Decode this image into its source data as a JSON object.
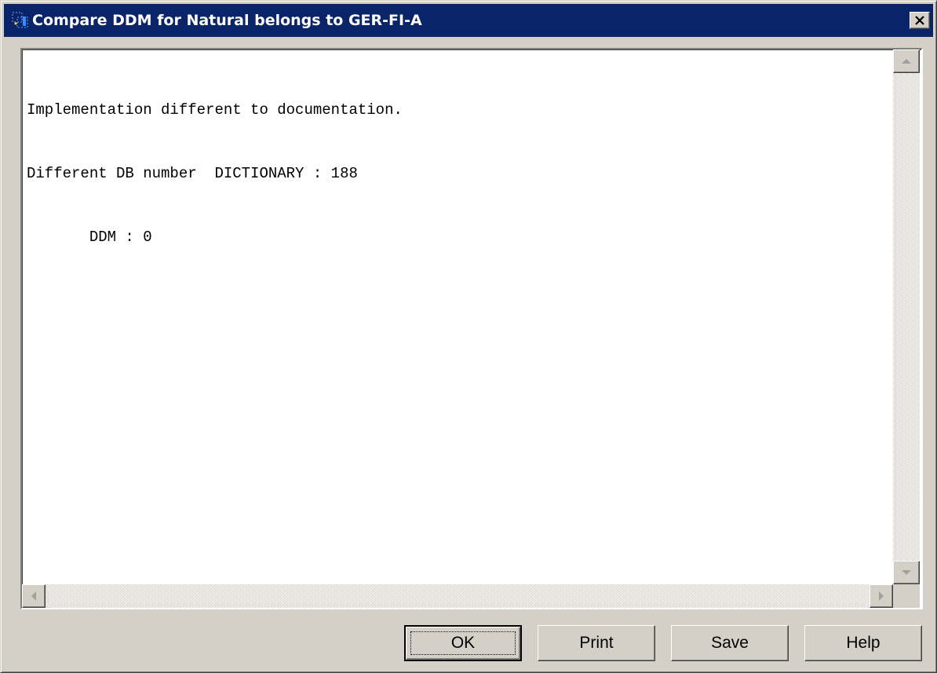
{
  "window": {
    "title": "Compare DDM for Natural belongs to GER-FI-A",
    "app_icon": "dialog-app-icon",
    "close_icon": "close-icon"
  },
  "report": {
    "lines": [
      "Implementation different to documentation.",
      "Different DB number  DICTIONARY : 188",
      "       DDM : 0"
    ]
  },
  "buttons": {
    "ok": "OK",
    "print": "Print",
    "save": "Save",
    "help": "Help"
  },
  "colors": {
    "titlebar": "#0a246a",
    "dialog_face": "#d4d0c8",
    "text_background": "#ffffff"
  }
}
